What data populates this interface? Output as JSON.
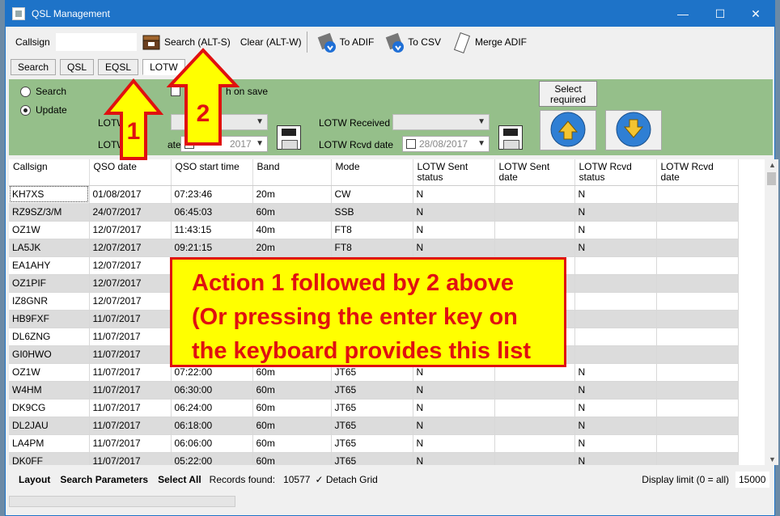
{
  "window": {
    "title": "QSL Management"
  },
  "titlebar": {
    "minimize": "—",
    "maximize": "☐",
    "close": "✕"
  },
  "toolbar": {
    "callsign_label": "Callsign",
    "callsign_value": "",
    "search_label": "Search (ALT-S)",
    "clear_label": "Clear (ALT-W)",
    "to_adif_label": "To ADIF",
    "to_csv_label": "To CSV",
    "merge_adif_label": "Merge ADIF"
  },
  "tabs": [
    "Search",
    "QSL",
    "EQSL",
    "LOTW"
  ],
  "panel": {
    "radio_search": "Search",
    "radio_update": "Update",
    "search_on_save_label": "h on save",
    "lotw_sent_label": "LOTW",
    "lotw_sent_date_label": "LOTW",
    "lotw_sent_date_suffix": "ate",
    "lotw_sent_date_value": "2017",
    "lotw_received_label": "LOTW Received",
    "lotw_rcvd_date_label": "LOTW Rcvd date",
    "lotw_rcvd_date_value": "28/08/2017",
    "select_required": "Select required"
  },
  "grid": {
    "columns": [
      "Callsign",
      "QSO date",
      "QSO start time",
      "Band",
      "Mode",
      "LOTW Sent status",
      "LOTW Sent date",
      "LOTW Rcvd status",
      "LOTW Rcvd date"
    ],
    "rows": [
      [
        "KH7XS",
        "01/08/2017",
        "07:23:46",
        "20m",
        "CW",
        "N",
        "",
        "N",
        ""
      ],
      [
        "RZ9SZ/3/M",
        "24/07/2017",
        "06:45:03",
        "60m",
        "SSB",
        "N",
        "",
        "N",
        ""
      ],
      [
        "OZ1W",
        "12/07/2017",
        "11:43:15",
        "40m",
        "FT8",
        "N",
        "",
        "N",
        ""
      ],
      [
        "LA5JK",
        "12/07/2017",
        "09:21:15",
        "20m",
        "FT8",
        "N",
        "",
        "N",
        ""
      ],
      [
        "EA1AHY",
        "12/07/2017",
        "",
        "",
        "",
        "",
        "",
        "",
        ""
      ],
      [
        "OZ1PIF",
        "12/07/2017",
        "",
        "",
        "",
        "",
        "",
        "",
        ""
      ],
      [
        "IZ8GNR",
        "12/07/2017",
        "",
        "",
        "",
        "",
        "",
        "",
        ""
      ],
      [
        "HB9FXF",
        "11/07/2017",
        "",
        "",
        "",
        "",
        "",
        "",
        ""
      ],
      [
        "DL6ZNG",
        "11/07/2017",
        "",
        "",
        "",
        "",
        "",
        "",
        ""
      ],
      [
        "GI0HWO",
        "11/07/2017",
        "",
        "",
        "",
        "",
        "",
        "",
        ""
      ],
      [
        "OZ1W",
        "11/07/2017",
        "07:22:00",
        "60m",
        "JT65",
        "N",
        "",
        "N",
        ""
      ],
      [
        "W4HM",
        "11/07/2017",
        "06:30:00",
        "60m",
        "JT65",
        "N",
        "",
        "N",
        ""
      ],
      [
        "DK9CG",
        "11/07/2017",
        "06:24:00",
        "60m",
        "JT65",
        "N",
        "",
        "N",
        ""
      ],
      [
        "DL2JAU",
        "11/07/2017",
        "06:18:00",
        "60m",
        "JT65",
        "N",
        "",
        "N",
        ""
      ],
      [
        "LA4PM",
        "11/07/2017",
        "06:06:00",
        "60m",
        "JT65",
        "N",
        "",
        "N",
        ""
      ],
      [
        "DK0FF",
        "11/07/2017",
        "05:22:00",
        "60m",
        "JT65",
        "N",
        "",
        "N",
        ""
      ]
    ]
  },
  "status": {
    "layout": "Layout",
    "search_params": "Search Parameters",
    "select_all": "Select All",
    "records_found_label": "Records found:",
    "records_found_value": "10577",
    "detach_grid": "✓ Detach Grid",
    "display_limit_label": "Display limit (0 = all)",
    "display_limit_value": "15000"
  },
  "annotation": {
    "line1": "Action 1 followed by 2 above",
    "line2": "(Or pressing the enter key on",
    "line3": "the keyboard provides this list",
    "arrow1": "1",
    "arrow2": "2"
  },
  "colors": {
    "titlebar": "#1e73c8",
    "panel": "#95bf8a",
    "annotation_bg": "#ffff00",
    "annotation_fg": "#e01010"
  }
}
